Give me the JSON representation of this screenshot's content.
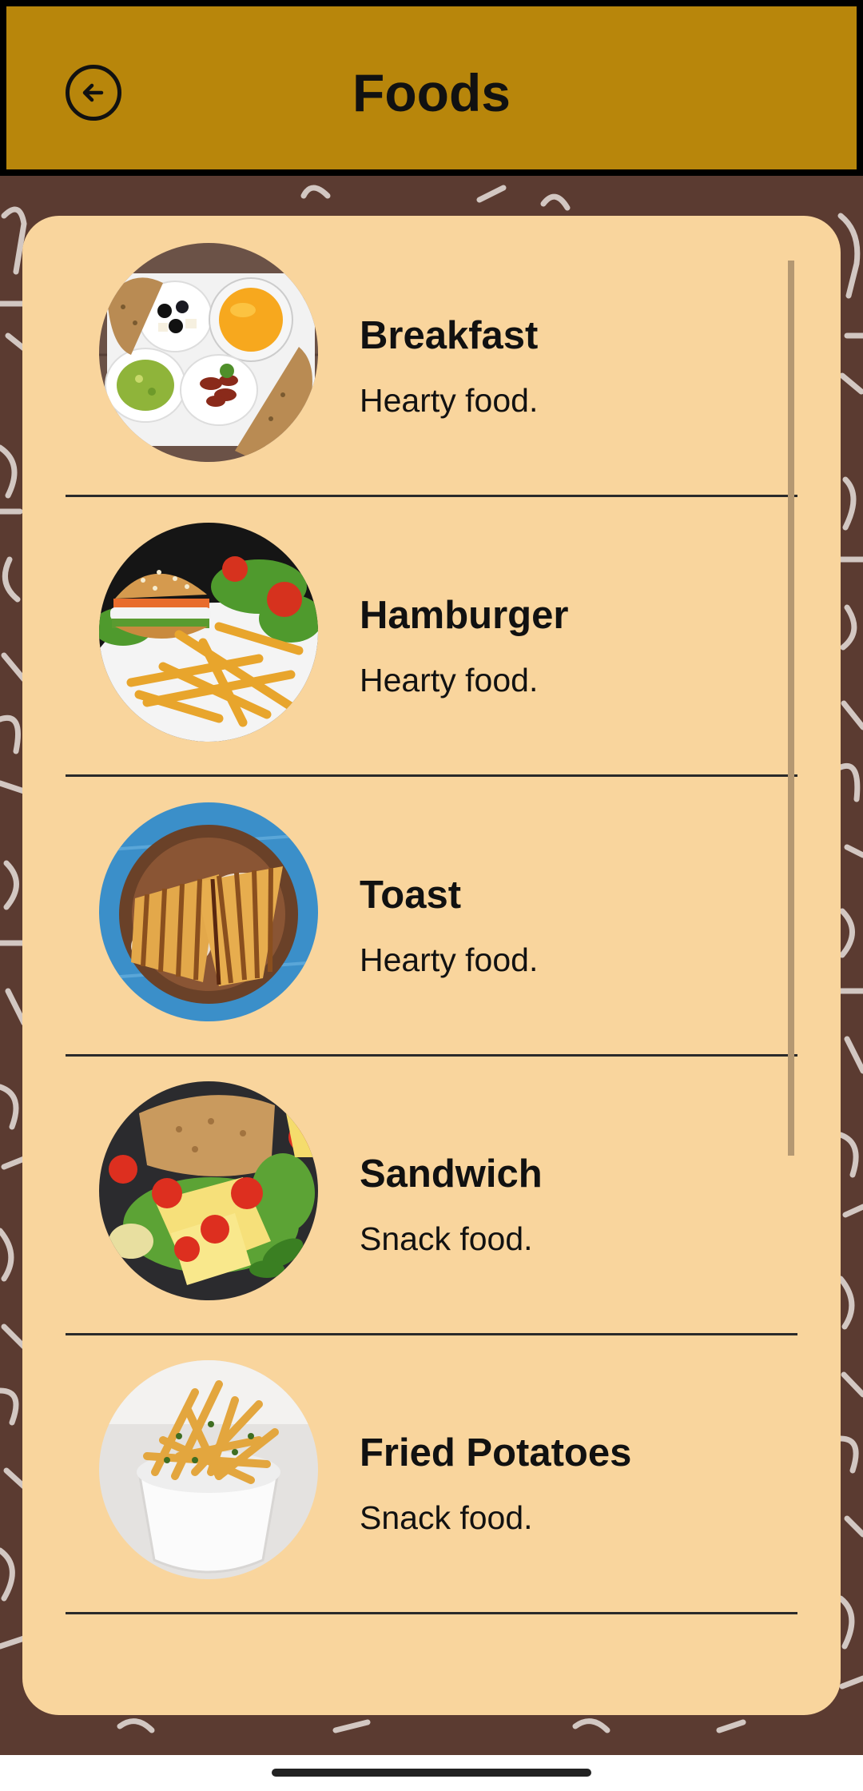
{
  "app_bar": {
    "title": "Foods",
    "back_icon": "arrow-left-circle-icon",
    "color": "#b8860b"
  },
  "colors": {
    "background": "#5b3b31",
    "card": "#f9d59d",
    "text": "#111111"
  },
  "foods": [
    {
      "name": "Breakfast",
      "description": "Hearty food.",
      "image": "breakfast-plate-image"
    },
    {
      "name": "Hamburger",
      "description": "Hearty food.",
      "image": "hamburger-fries-image"
    },
    {
      "name": "Toast",
      "description": "Hearty food.",
      "image": "grilled-toast-image"
    },
    {
      "name": "Sandwich",
      "description": "Snack food.",
      "image": "sandwich-ingredients-image"
    },
    {
      "name": "Fried Potatoes",
      "description": "Snack food.",
      "image": "fried-potatoes-bowl-image"
    }
  ]
}
